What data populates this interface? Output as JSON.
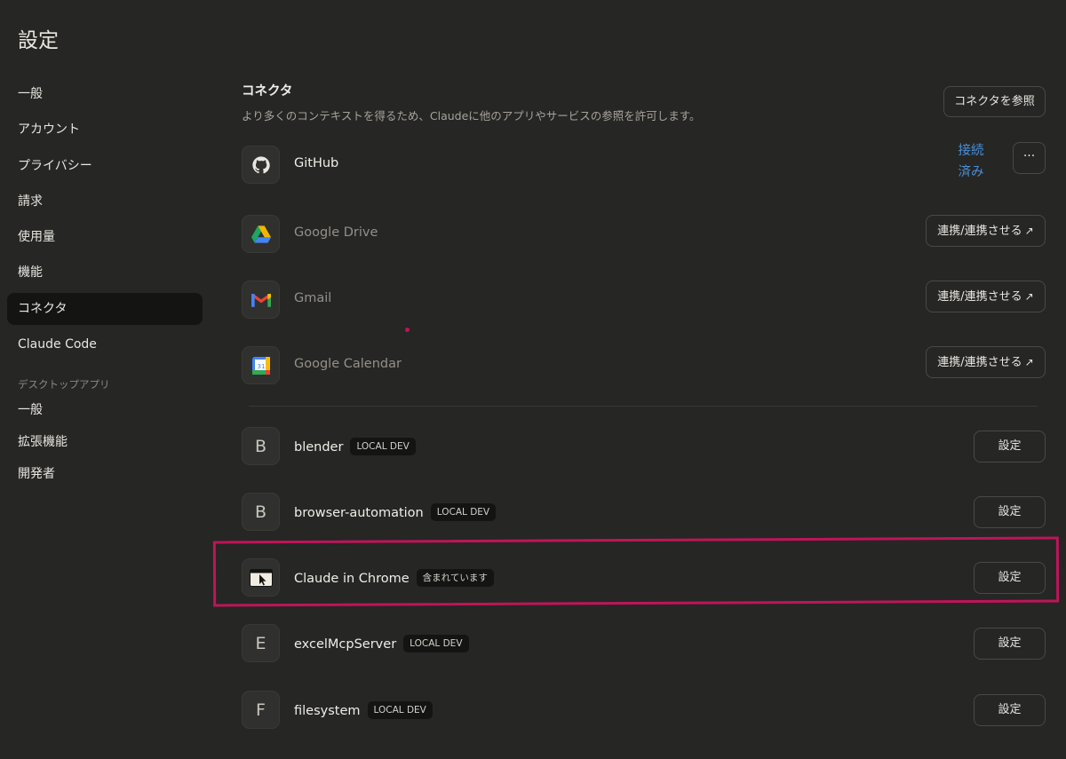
{
  "page": {
    "title": "設定"
  },
  "sidebar": {
    "items": [
      {
        "label": "一般"
      },
      {
        "label": "アカウント"
      },
      {
        "label": "プライバシー"
      },
      {
        "label": "請求"
      },
      {
        "label": "使用量"
      },
      {
        "label": "機能"
      },
      {
        "label": "コネクタ",
        "active": true
      },
      {
        "label": "Claude Code"
      }
    ],
    "desktop_section_label": "デスクトップアプリ",
    "desktop_items": [
      {
        "label": "一般"
      },
      {
        "label": "拡張機能"
      },
      {
        "label": "開発者"
      }
    ]
  },
  "connectors": {
    "title": "コネクタ",
    "description": "より多くのコンテキストを得るため、Claudeに他のアプリやサービスの参照を許可します。",
    "browse_label": "コネクタを参照",
    "integrations": [
      {
        "name": "GitHub",
        "icon": "github-icon",
        "status_line1": "接続",
        "status_line2": "済み",
        "more_label": "···"
      },
      {
        "name": "Google Drive",
        "icon": "google-drive-icon",
        "action_label": "連携/連携させる"
      },
      {
        "name": "Gmail",
        "icon": "gmail-icon",
        "action_label": "連携/連携させる"
      },
      {
        "name": "Google Calendar",
        "icon": "google-calendar-icon",
        "action_label": "連携/連携させる"
      }
    ],
    "local": [
      {
        "letter": "B",
        "name": "blender",
        "badge": "LOCAL DEV",
        "action_label": "設定"
      },
      {
        "letter": "B",
        "name": "browser-automation",
        "badge": "LOCAL DEV",
        "action_label": "設定"
      },
      {
        "letter": "",
        "name": "Claude in Chrome",
        "badge": "含まれています",
        "action_label": "設定",
        "icon": "browser-cursor-icon"
      },
      {
        "letter": "E",
        "name": "excelMcpServer",
        "badge": "LOCAL DEV",
        "action_label": "設定"
      },
      {
        "letter": "F",
        "name": "filesystem",
        "badge": "LOCAL DEV",
        "action_label": "設定"
      }
    ]
  },
  "colors": {
    "accent": "#4a8fd6",
    "annotation": "#c0145a",
    "background": "#262624"
  }
}
